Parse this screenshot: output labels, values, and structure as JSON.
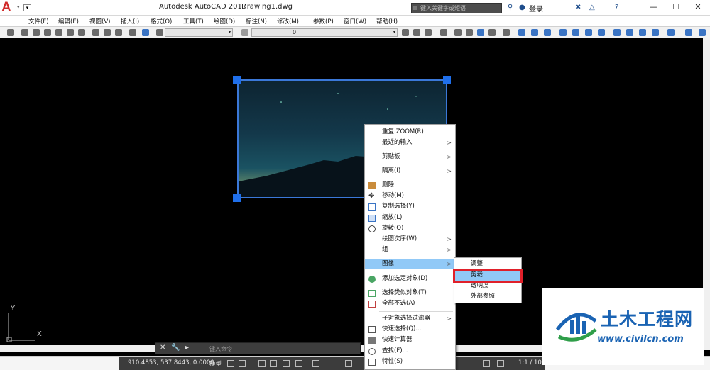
{
  "titlebar": {
    "app_name": "Autodesk AutoCAD 2017",
    "document": "Drawing1.dwg",
    "search_placeholder": "键入关键字或短语",
    "login_label": "登录",
    "help_label": "?",
    "min": "—",
    "max": "☐",
    "close": "✕"
  },
  "menubar": {
    "items": [
      "文件(F)",
      "编辑(E)",
      "视图(V)",
      "插入(I)",
      "格式(O)",
      "工具(T)",
      "绘图(D)",
      "标注(N)",
      "修改(M)",
      "参数(P)",
      "窗口(W)",
      "帮助(H)"
    ]
  },
  "toolbar": {
    "layer_value": "0"
  },
  "context_menu": {
    "items": [
      {
        "label": "重复.ZOOM(R)"
      },
      {
        "label": "最近的输入",
        "submenu": ">"
      },
      {
        "label": "剪贴板",
        "submenu": ">"
      },
      {
        "label": "隔离(I)",
        "submenu": ">"
      },
      {
        "label": "删除"
      },
      {
        "label": "移动(M)"
      },
      {
        "label": "复制选择(Y)"
      },
      {
        "label": "缩放(L)"
      },
      {
        "label": "旋转(O)"
      },
      {
        "label": "绘图次序(W)",
        "submenu": ">"
      },
      {
        "label": "组",
        "submenu": ">"
      },
      {
        "label": "图像",
        "submenu": ">"
      },
      {
        "label": "添加选定对象(D)"
      },
      {
        "label": "选择类似对象(T)"
      },
      {
        "label": "全部不选(A)"
      },
      {
        "label": "子对象选择过滤器",
        "submenu": ">"
      },
      {
        "label": "快速选择(Q)..."
      },
      {
        "label": "快速计算器"
      },
      {
        "label": "查找(F)..."
      },
      {
        "label": "特性(S)"
      }
    ]
  },
  "image_submenu": {
    "items": [
      "调整",
      "剪裁",
      "透明度",
      "外部参照"
    ]
  },
  "ucs": {
    "y_label": "Y",
    "x_label": "X"
  },
  "command_line": {
    "close": "✕",
    "wrench": "🔧",
    "placeholder": "键入命令"
  },
  "statusbar": {
    "coordinates": "910.4853, 537.8443, 0.0000",
    "model_label": "模型",
    "scale_label": "1:1 / 100%"
  },
  "watermark": {
    "title": "土木工程网",
    "url": "www.civilcn.com"
  },
  "colors": {
    "selection": "#1f6feb",
    "highlight": "#91c9f7",
    "callout": "#e0202a",
    "brand": "#1a63b3"
  }
}
